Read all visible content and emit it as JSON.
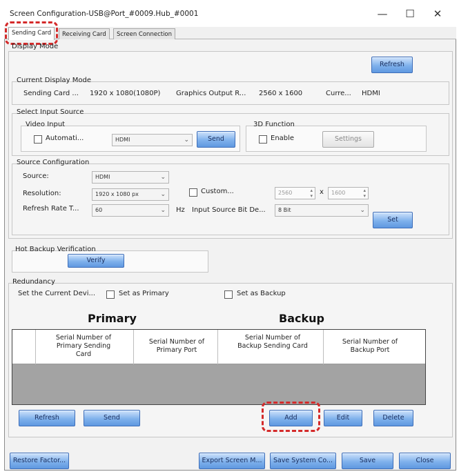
{
  "window": {
    "title": "Screen Configuration-USB@Port_#0009.Hub_#0001",
    "minimize_glyph": "—",
    "maximize_glyph": "☐",
    "close_glyph": "✕"
  },
  "tabs": [
    {
      "label": "Sending Card",
      "active": true
    },
    {
      "label": "Receiving Card",
      "active": false
    },
    {
      "label": "Screen Connection",
      "active": false
    }
  ],
  "display_mode": {
    "group_label": "Display Mode",
    "refresh_label": "Refresh",
    "current_label": "Current Display Mode",
    "sending_card_label": "Sending Card ...",
    "sending_card_value": "1920 x 1080(1080P)",
    "graphics_label": "Graphics Output R...",
    "graphics_value": "2560 x 1600",
    "current_label_short": "Curre...",
    "current_value": "HDMI"
  },
  "input_source": {
    "group_label": "Select Input Source",
    "video_input_label": "Video Input",
    "auto_label": "Automati...",
    "source_value": "HDMI",
    "send_label": "Send",
    "function_3d_label": "3D Function",
    "enable_label": "Enable",
    "settings_label": "Settings"
  },
  "source_config": {
    "group_label": "Source Configuration",
    "source_label": "Source:",
    "source_value": "HDMI",
    "resolution_label": "Resolution:",
    "resolution_value": "1920 x 1080 px",
    "custom_label": "Custom...",
    "width_value": "2560",
    "x_label": "x",
    "height_value": "1600",
    "refresh_rate_label": "Refresh Rate T...",
    "refresh_rate_value": "60",
    "hz_label": "Hz",
    "bit_depth_label": "Input Source Bit De...",
    "bit_depth_value": "8 Bit",
    "set_label": "Set"
  },
  "hot_backup": {
    "group_label": "Hot Backup Verification",
    "verify_label": "Verify"
  },
  "redundancy": {
    "group_label": "Redundancy",
    "set_current_label": "Set the Current Devi...",
    "set_primary_label": "Set as Primary",
    "set_backup_label": "Set as Backup",
    "primary_heading": "Primary",
    "backup_heading": "Backup",
    "columns": [
      "",
      "Serial Number of Primary Sending Card",
      "Serial Number of Primary Port",
      "Serial Number of Backup Sending Card",
      "Serial Number of Backup Port"
    ],
    "refresh_label": "Refresh",
    "send_label": "Send",
    "add_label": "Add",
    "edit_label": "Edit",
    "delete_label": "Delete"
  },
  "footer": {
    "restore_label": "Restore Factor...",
    "export_label": "Export Screen M...",
    "save_system_label": "Save System Co...",
    "save_label": "Save",
    "close_label": "Close"
  },
  "colors": {
    "button_blue": "#7fb1ec",
    "table_empty_area": "#a3a3a3",
    "callout_red": "#d42a2a"
  }
}
